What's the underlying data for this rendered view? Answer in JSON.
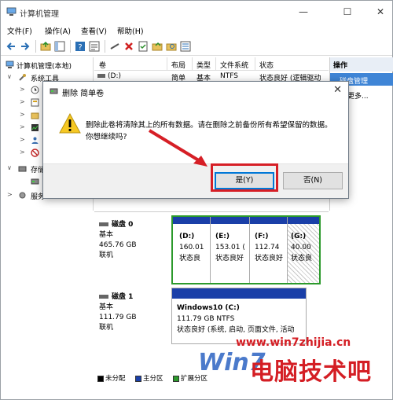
{
  "window": {
    "title": "计算机管理"
  },
  "menubar": {
    "file": "文件(F)",
    "action": "操作(A)",
    "view": "查看(V)",
    "help": "帮助(H)"
  },
  "tree": {
    "root": "计算机管理(本地)",
    "system_tools": "系统工具",
    "storage": "存储",
    "services": "服务"
  },
  "grid": {
    "headers": [
      "卷",
      "布局",
      "类型",
      "文件系统",
      "状态"
    ],
    "row": {
      "volume": "(D:)",
      "layout": "简单",
      "type": "基本",
      "fs": "NTFS",
      "status": "状态良好 (逻辑驱动"
    }
  },
  "actions": {
    "header": "操作",
    "selected": "磁盘管理",
    "more": "更多..."
  },
  "disks": [
    {
      "title": "磁盘 0",
      "kind": "基本",
      "size": "465.76 GB",
      "state": "联机",
      "partitions": [
        {
          "label": "(D:)",
          "size": "160.01",
          "status": "状态良"
        },
        {
          "label": "(E:)",
          "size": "153.01 (",
          "status": "状态良好"
        },
        {
          "label": "(F:)",
          "size": "112.74",
          "status": "状态良好"
        },
        {
          "label": "(G:)",
          "size": "40.00",
          "status": "状态良"
        }
      ]
    },
    {
      "title": "磁盘 1",
      "kind": "基本",
      "size": "111.79 GB",
      "state": "联机",
      "partitions": [
        {
          "label": "Windows10  (C:)",
          "size": "111.79 GB NTFS",
          "status": "状态良好 (系统, 启动, 页面文件, 活动"
        }
      ]
    }
  ],
  "legend": [
    "未分配",
    "主分区",
    "扩展分区"
  ],
  "dialog": {
    "title": "删除 简单卷",
    "message": "删除此卷将清除其上的所有数据。请在删除之前备份所有希望保留的数据。你想继续吗?",
    "yes_label": "是(Y)",
    "no_label": "否(N)"
  },
  "watermark": {
    "url": "www.win7zhijia.cn",
    "brand": "电脑技术吧",
    "win": "Win7"
  },
  "colors": {
    "primary_partition": "#1a3fa8",
    "highlight": "#d61f26",
    "accent": "#0078d7"
  }
}
